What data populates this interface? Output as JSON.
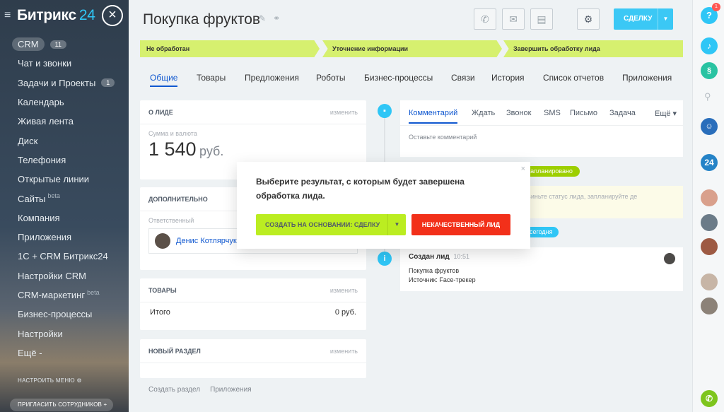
{
  "sidebar": {
    "logo": "Битрикс",
    "logo_num": "24",
    "items": [
      {
        "label": "CRM",
        "badge": "11"
      },
      {
        "label": "Чат и звонки"
      },
      {
        "label": "Задачи и Проекты",
        "badge": "1"
      },
      {
        "label": "Календарь"
      },
      {
        "label": "Живая лента"
      },
      {
        "label": "Диск"
      },
      {
        "label": "Телефония"
      },
      {
        "label": "Открытые линии"
      },
      {
        "label": "Сайты",
        "beta": "beta"
      },
      {
        "label": "Компания"
      },
      {
        "label": "Приложения"
      },
      {
        "label": "1С + CRM Битрикс24"
      },
      {
        "label": "Настройки CRM"
      },
      {
        "label": "CRM-маркетинг",
        "beta": "beta"
      },
      {
        "label": "Бизнес-процессы"
      },
      {
        "label": "Настройки"
      },
      {
        "label": "Ещё -"
      }
    ],
    "settings_label": "НАСТРОИТЬ МЕНЮ ⚙",
    "invite_label": "ПРИГЛАСИТЬ СОТРУДНИКОВ +"
  },
  "header": {
    "title": "Покупка фруктов",
    "deal_button": "СДЕЛКУ"
  },
  "stages": [
    "Не обработан",
    "Уточнение информации",
    "Завершить обработку лида"
  ],
  "tabs": [
    "Общие",
    "Товары",
    "Предложения",
    "Роботы",
    "Бизнес-процессы",
    "Связи",
    "История",
    "Список отчетов",
    "Приложения"
  ],
  "about": {
    "title": "О ЛИДЕ",
    "edit": "изменить",
    "amount_label": "Сумма и валюта",
    "amount": "1 540",
    "currency": "руб."
  },
  "additional": {
    "title": "ДОПОЛНИТЕЛЬНО",
    "responsible_label": "Ответственный",
    "responsible_name": "Денис Котлярчук"
  },
  "goods": {
    "title": "ТОВАРЫ",
    "edit": "изменить",
    "total_label": "Итого",
    "total_value": "0 руб."
  },
  "new_section": {
    "title": "НОВЫЙ РАЗДЕЛ",
    "edit": "изменить"
  },
  "footer_links": [
    "Создать раздел",
    "Приложения"
  ],
  "editor": {
    "tabs": [
      "Комментарий",
      "Ждать",
      "Звонок",
      "SMS",
      "Письмо",
      "Задача",
      "Ещё ▾"
    ],
    "placeholder": "Оставьте комментарий"
  },
  "timeline": {
    "planned_tag": "запланировано",
    "planned_hint": "одвиньте статус лида, запланируйте де",
    "today_tag": "сегодня",
    "created_title": "Создан лид",
    "created_time": "10:51",
    "created_line1": "Покупка фруктов",
    "created_line2": "Источник: Face-трекер"
  },
  "modal": {
    "text": "Выберите результат, с которым будет завершена обработка лида.",
    "green_button": "СОЗДАТЬ НА ОСНОВАНИИ: СДЕЛКУ",
    "red_button": "НЕКАЧЕСТВЕННЫЙ ЛИД"
  },
  "rightbar": {
    "help_badge": "1",
    "counter": "24"
  },
  "colors": {
    "accent": "#2fc6f6",
    "stage": "#d6f06f",
    "green_btn": "#bbed21",
    "red_btn": "#f2301a",
    "link": "#1058d0"
  }
}
